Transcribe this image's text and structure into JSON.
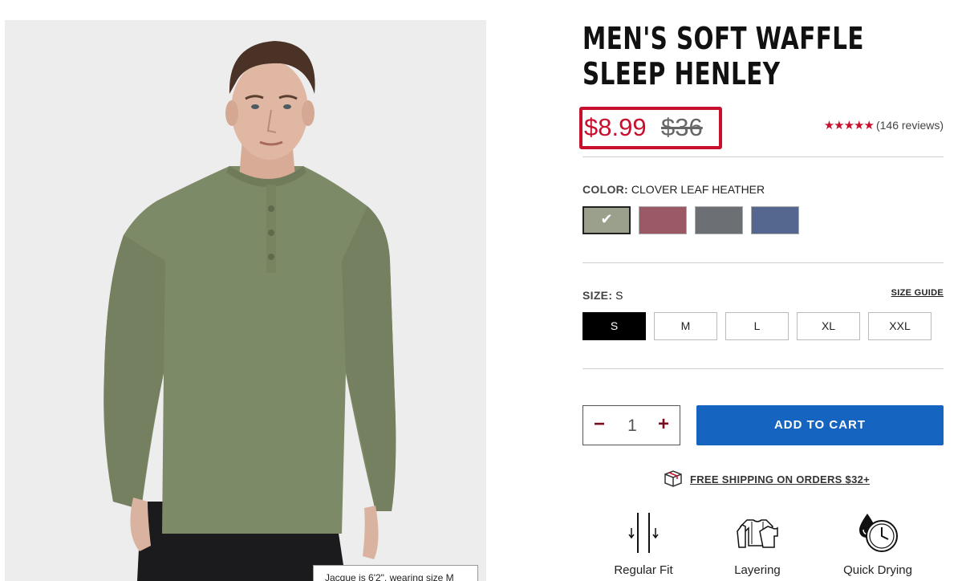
{
  "product": {
    "title": "MEN'S SOFT WAFFLE SLEEP HENLEY",
    "sale_price": "$8.99",
    "original_price": "$36",
    "rating_stars": "★★★★★",
    "review_count": "(146 reviews)",
    "image_caption": "Jacque is 6'2\", wearing size M"
  },
  "color": {
    "label": "COLOR:",
    "selected_name": "CLOVER LEAF HEATHER",
    "swatches": [
      {
        "name": "clover-leaf-heather",
        "hex": "#9aa08c",
        "selected": true
      },
      {
        "name": "rose",
        "hex": "#9a5965",
        "selected": false
      },
      {
        "name": "charcoal",
        "hex": "#6c7075",
        "selected": false
      },
      {
        "name": "navy-blue",
        "hex": "#55668f",
        "selected": false
      }
    ],
    "check_glyph": "✔"
  },
  "size": {
    "label": "SIZE:",
    "selected": "S",
    "guide_label": "SIZE GUIDE",
    "options": [
      "S",
      "M",
      "L",
      "XL",
      "XXL"
    ]
  },
  "quantity": {
    "minus": "−",
    "value": "1",
    "plus": "+"
  },
  "cart": {
    "add_label": "ADD TO CART"
  },
  "shipping": {
    "label": "FREE SHIPPING ON ORDERS $32+",
    "icon": "box-icon"
  },
  "features": [
    {
      "label": "Regular Fit",
      "icon": "regular-fit-icon"
    },
    {
      "label": "Layering",
      "icon": "layering-icon"
    },
    {
      "label": "Quick Drying",
      "icon": "quick-drying-icon"
    }
  ],
  "colors": {
    "accent_red": "#c8102e",
    "cart_blue": "#1565c0",
    "shirt_green": "#7d8a68"
  }
}
